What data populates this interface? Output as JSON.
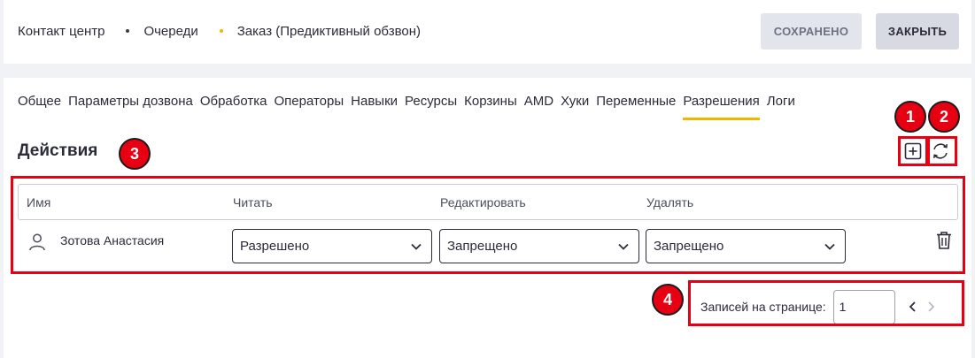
{
  "breadcrumbs": [
    {
      "label": "Контакт центр"
    },
    {
      "label": "Очереди",
      "dot_color": "#3a3a4a"
    },
    {
      "label": "Заказ (Предиктивный обзвон)",
      "dot_color": "#f5b400"
    }
  ],
  "header": {
    "saved_label": "СОХРАНЕНО",
    "close_label": "ЗАКРЫТЬ"
  },
  "tabs": [
    {
      "label": "Общее"
    },
    {
      "label": "Параметры дозвона"
    },
    {
      "label": "Обработка"
    },
    {
      "label": "Операторы"
    },
    {
      "label": "Навыки"
    },
    {
      "label": "Ресурсы"
    },
    {
      "label": "Корзины"
    },
    {
      "label": "AMD"
    },
    {
      "label": "Хуки"
    },
    {
      "label": "Переменные"
    },
    {
      "label": "Разрешения",
      "active": true
    },
    {
      "label": "Логи"
    }
  ],
  "section": {
    "title": "Действия"
  },
  "table": {
    "columns": [
      "Имя",
      "Читать",
      "Редактировать",
      "Удалять"
    ],
    "rows": [
      {
        "name": "Зотова Анастасия",
        "read": "Разрешено",
        "edit": "Запрещено",
        "delete": "Запрещено"
      }
    ]
  },
  "pagination": {
    "label": "Записей на странице:",
    "value": "1"
  },
  "markers": [
    "1",
    "2",
    "3",
    "4"
  ],
  "colors": {
    "accent": "#f5b400",
    "annotation": "#e60012"
  }
}
